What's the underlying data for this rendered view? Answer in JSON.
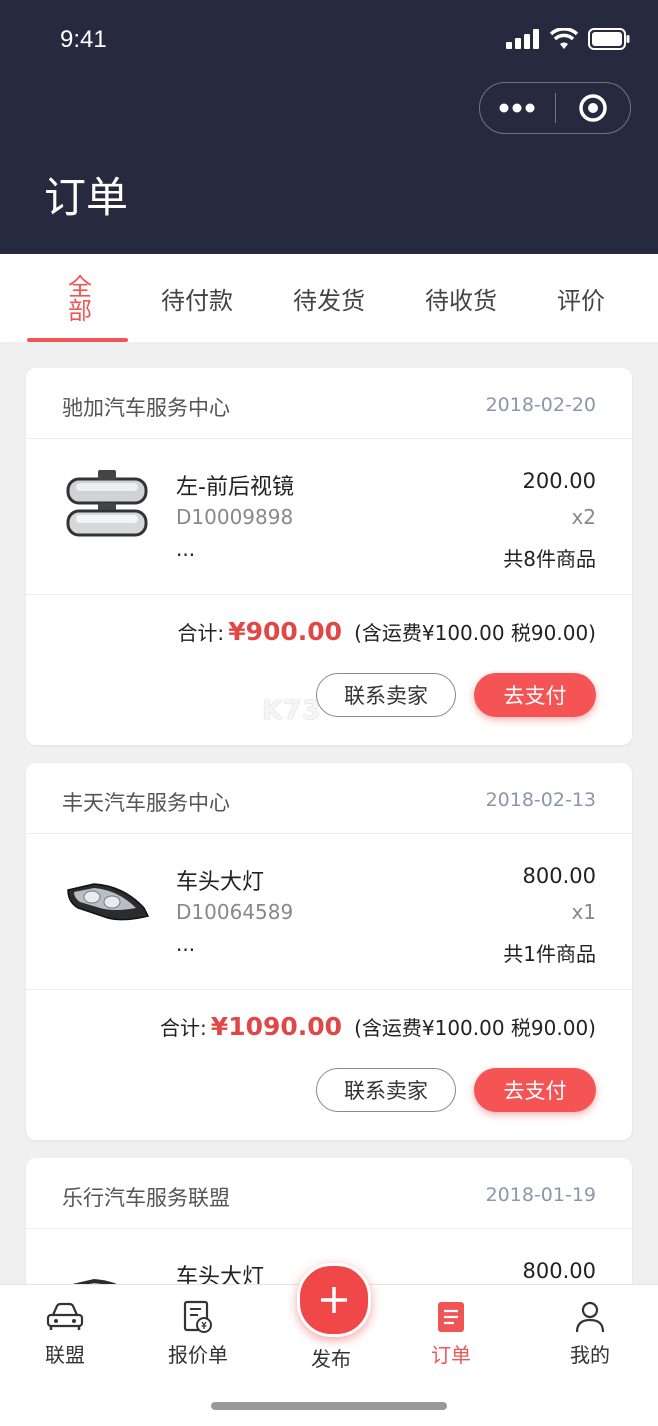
{
  "status_bar": {
    "time": "9:41"
  },
  "header": {
    "title": "订单"
  },
  "tabs": [
    {
      "label": "全部",
      "active": true
    },
    {
      "label": "待付款"
    },
    {
      "label": "待发货"
    },
    {
      "label": "待收货"
    },
    {
      "label": "评价"
    }
  ],
  "orders": [
    {
      "shop": "驰加汽车服务中心",
      "date": "2018-02-20",
      "product": "左-前后视镜",
      "code": "D10009898",
      "more": "...",
      "price": "200.00",
      "qty": "x2",
      "count": "共8件商品",
      "total_label": "合计:",
      "total": "¥900.00",
      "fee": "(含运费¥100.00 税90.00)",
      "contact_label": "联系卖家",
      "pay_label": "去支付"
    },
    {
      "shop": "丰天汽车服务中心",
      "date": "2018-02-13",
      "product": "车头大灯",
      "code": "D10064589",
      "more": "...",
      "price": "800.00",
      "qty": "x1",
      "count": "共1件商品",
      "total_label": "合计:",
      "total": "¥1090.00",
      "fee": "(含运费¥100.00 税90.00)",
      "contact_label": "联系卖家",
      "pay_label": "去支付"
    },
    {
      "shop": "乐行汽车服务联盟",
      "date": "2018-01-19",
      "product": "车头大灯",
      "price": "800.00"
    }
  ],
  "watermark": "K73",
  "bottom_nav": [
    {
      "label": "联盟",
      "icon": "car-icon"
    },
    {
      "label": "报价单",
      "icon": "quote-icon"
    },
    {
      "label": "发布",
      "icon": "plus-icon"
    },
    {
      "label": "订单",
      "icon": "order-icon",
      "active": true
    },
    {
      "label": "我的",
      "icon": "user-icon"
    }
  ],
  "colors": {
    "header_bg": "#27293f",
    "accent": "#f05555",
    "pay_button": "#f55454"
  }
}
